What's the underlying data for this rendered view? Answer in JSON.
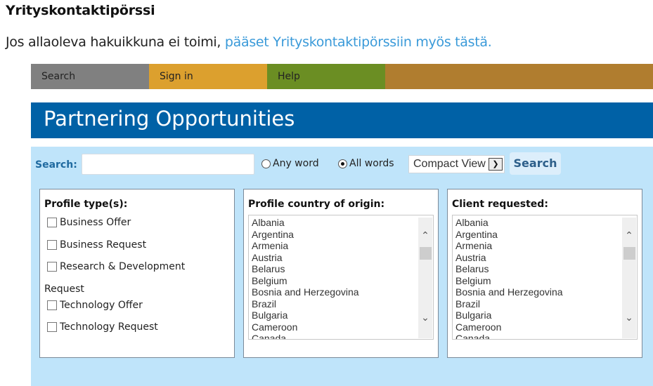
{
  "header": {
    "title": "Yrityskontaktipörssi",
    "intro_text": "Jos allaoleva hakuikkuna ei toimi, ",
    "intro_link": "pääset Yrityskontaktipörssiin myös tästä."
  },
  "nav": {
    "items": [
      {
        "label": "Search"
      },
      {
        "label": "Sign in"
      },
      {
        "label": "Help"
      }
    ],
    "colors": {
      "search": "#808080",
      "signin": "#dca02e",
      "help": "#6b8e23",
      "filler": "#b07d2f"
    }
  },
  "banner": {
    "title": "Partnering Opportunities",
    "color": "#0061a6"
  },
  "search": {
    "label": "Search:",
    "input_value": "",
    "input_placeholder": "",
    "radio_any": {
      "label": "Any word",
      "selected": false
    },
    "radio_all": {
      "label": "All words",
      "selected": true
    },
    "view_select": {
      "selected": "Compact View",
      "arrow_icon": "chevron-down-icon"
    },
    "button_label": "Search"
  },
  "profile_types": {
    "heading": "Profile type(s):",
    "items": [
      {
        "label": "Business Offer",
        "checked": false
      },
      {
        "label": "Business Request",
        "checked": false
      },
      {
        "label": "Research & Development",
        "checked": false
      }
    ],
    "group_label": "Request",
    "group_items": [
      {
        "label": "Technology Offer",
        "checked": false
      },
      {
        "label": "Technology Request",
        "checked": false
      }
    ]
  },
  "country_origin": {
    "heading": "Profile country of origin:",
    "options": [
      "Albania",
      "Argentina",
      "Armenia",
      "Austria",
      "Belarus",
      "Belgium",
      "Bosnia and Herzegovina",
      "Brazil",
      "Bulgaria",
      "Cameroon",
      "Canada"
    ]
  },
  "client_requested": {
    "heading": "Client requested:",
    "options": [
      "Albania",
      "Argentina",
      "Armenia",
      "Austria",
      "Belarus",
      "Belgium",
      "Bosnia and Herzegovina",
      "Brazil",
      "Bulgaria",
      "Cameroon",
      "Canada"
    ]
  }
}
